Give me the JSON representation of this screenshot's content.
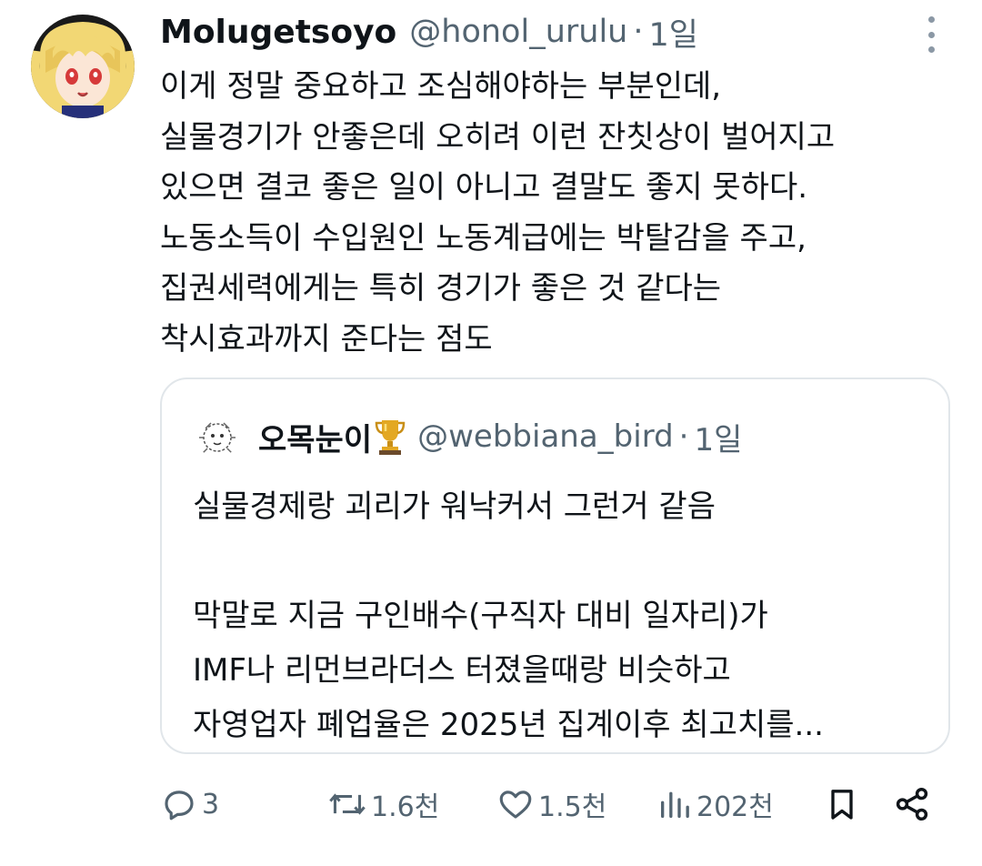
{
  "tweet": {
    "author_name": "Molugetsoyo",
    "author_handle": "@honol_urulu",
    "separator": "·",
    "time": "1일",
    "lines": [
      "이게 정말 중요하고 조심해야하는 부분인데,",
      "실물경기가 안좋은데 오히려 이런 잔칫상이 벌어지고",
      "있으면 결코 좋은 일이 아니고 결말도 좋지 못하다.",
      "노동소득이 수입원인 노동계급에는 박탈감을 주고,",
      "집권세력에게는 특히 경기가 좋은 것 같다는",
      "착시효과까지 준다는 점도"
    ]
  },
  "quote": {
    "author_name": "오목눈이",
    "author_handle": "@webbiana_bird",
    "separator": "·",
    "time": "1일",
    "lines": [
      "실물경제랑 괴리가 워낙커서 그런거 같음",
      "",
      "막말로 지금 구인배수(구직자 대비 일자리)가",
      "IMF나 리먼브라더스 터졌을때랑 비슷하고",
      "자영업자 폐업율은 2025년 집계이후 최고치를..."
    ]
  },
  "actions": {
    "reply_count": "3",
    "repost_count": "1.6천",
    "like_count": "1.5천",
    "views_count": "202천"
  },
  "icons": {
    "reply": "reply-icon",
    "repost": "repost-icon",
    "like": "heart-icon",
    "views": "views-icon",
    "bookmark": "bookmark-icon",
    "share": "share-icon",
    "more": "more-icon",
    "trophy": "trophy-icon"
  },
  "colors": {
    "text": "#0f1419",
    "secondary": "#536471",
    "border": "#e1e6ea"
  }
}
